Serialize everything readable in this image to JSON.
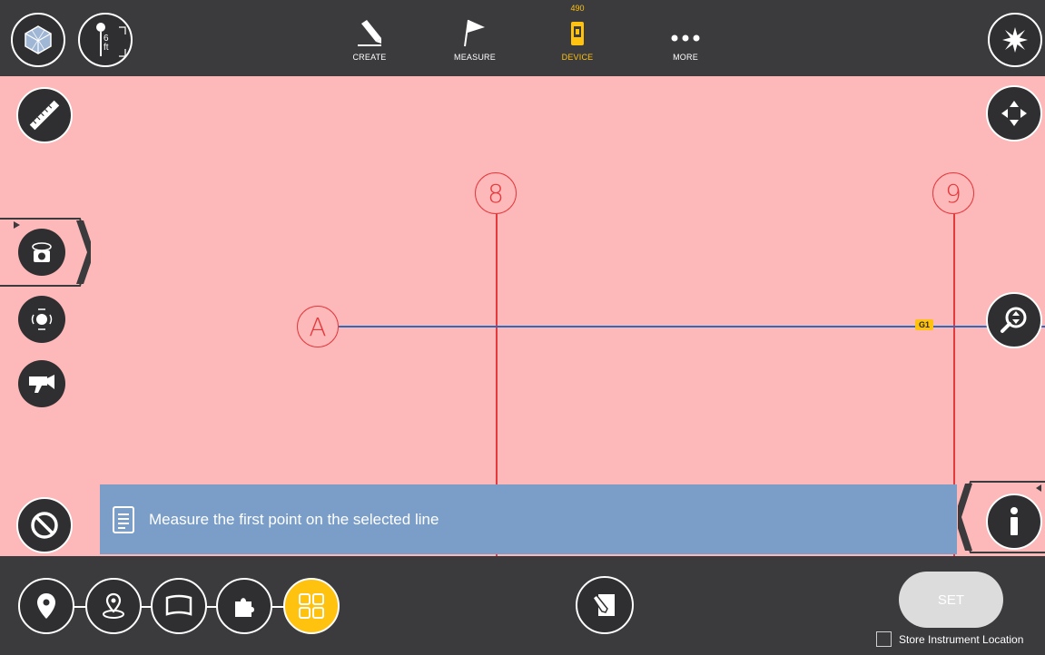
{
  "top_nav": {
    "create_label": "CREATE",
    "measure_label": "MEASURE",
    "device_label": "DEVICE",
    "device_badge": "490",
    "more_label": "MORE"
  },
  "rod_height": {
    "value": "6",
    "unit": "ft"
  },
  "grid": {
    "bubble_8": "8",
    "bubble_9": "9",
    "bubble_a": "A",
    "tag_g1": "G1",
    "line_color": "#e4393d",
    "selected_line_color": "#2d6bbf"
  },
  "message": {
    "text": "Measure the first point on the selected line"
  },
  "bottom": {
    "set_label": "SET",
    "store_label": "Store Instrument Location"
  },
  "colors": {
    "canvas": "#fdb8b9",
    "bar": "#3b3b3e",
    "accent": "#ffc20e",
    "message_bg": "#7a9ec8"
  }
}
